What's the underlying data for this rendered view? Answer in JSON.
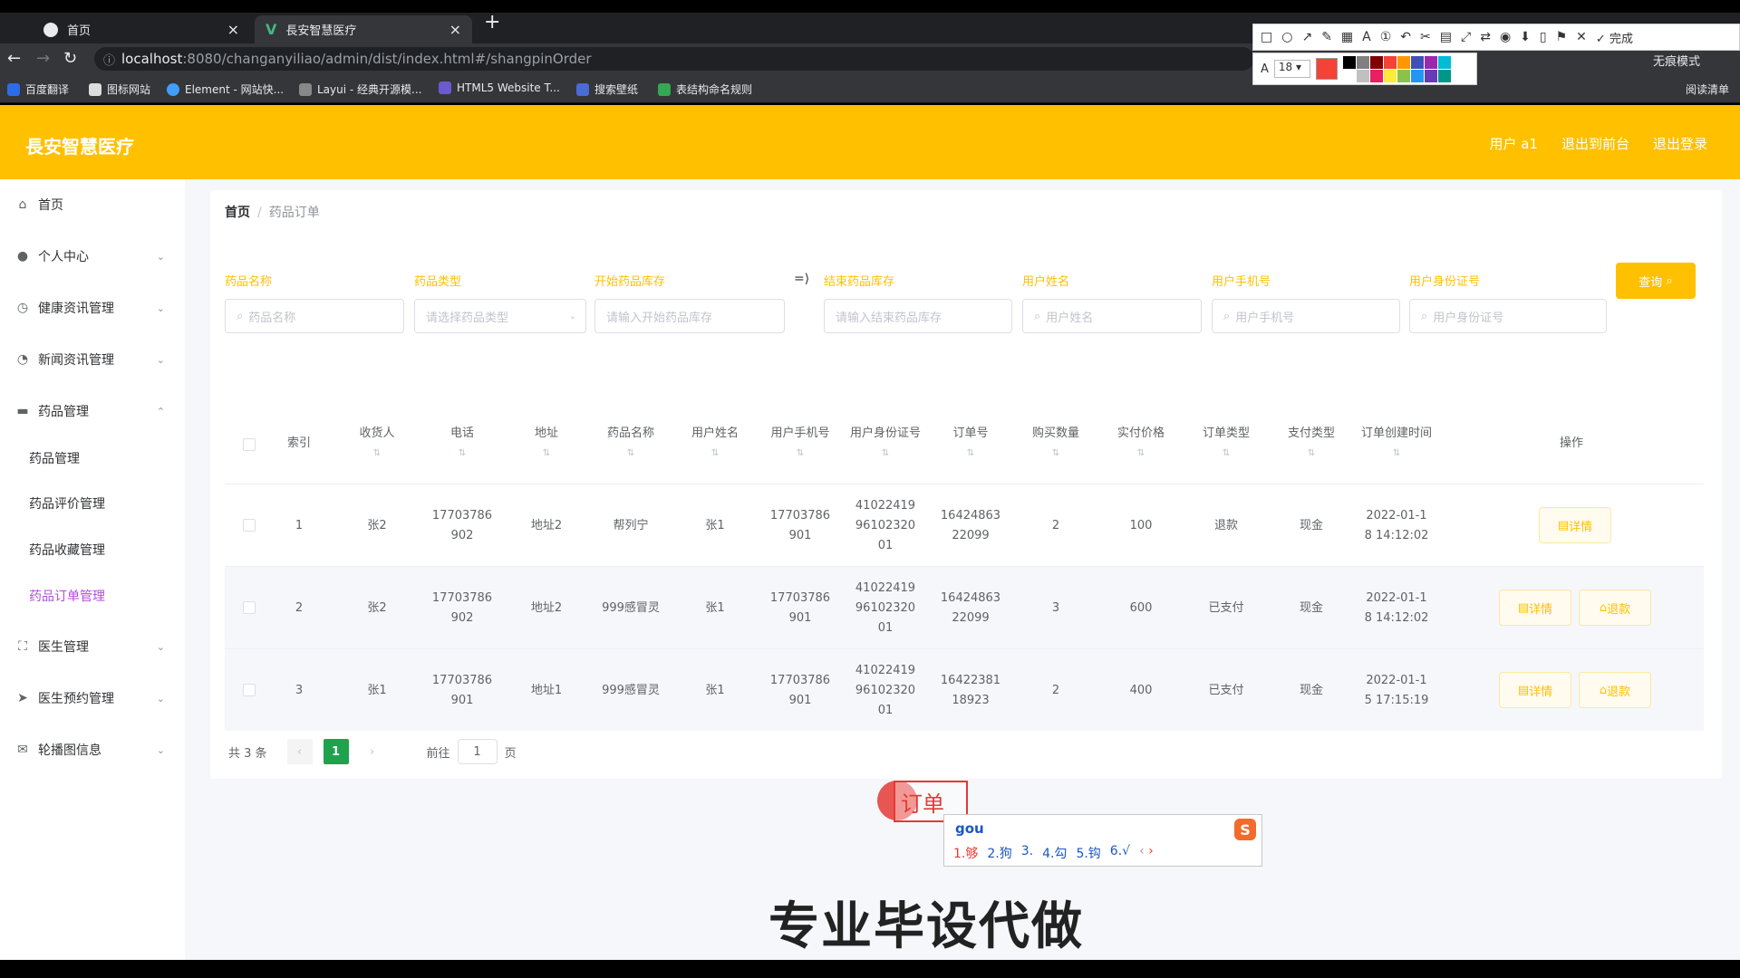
{
  "browser": {
    "tabs": [
      {
        "label": "首页"
      },
      {
        "label": "長安智慧医疗"
      }
    ],
    "url_host": "localhost",
    "url_path": ":8080/changanyiliao/admin/dist/index.html#/shangpinOrder",
    "incognito_label": "无痕模式",
    "bookmarks": [
      "百度翻译",
      "图标网站",
      "Element - 网站快...",
      "Layui - 经典开源模...",
      "HTML5 Website T...",
      "搜索壁纸",
      "表结构命名规则"
    ],
    "reading_list": "阅读清单"
  },
  "screenshot_tool": {
    "done_label": "完成",
    "font_size": "18",
    "current_color": "#f44336",
    "palette": [
      "#000000",
      "#808080",
      "#800000",
      "#f44336",
      "#ff9800",
      "#3f51b5",
      "#9c27b0",
      "#00bcd4",
      "#ffffff",
      "#c0c0c0",
      "#e91e63",
      "#ffeb3b",
      "#8bc34a",
      "#2196f3",
      "#673ab7",
      "#009688"
    ]
  },
  "app": {
    "title": "長安智慧医疗",
    "header_links": [
      "用户 a1",
      "退出到前台",
      "退出登录"
    ],
    "accent_color": "#ffc000"
  },
  "sidebar": {
    "items": [
      {
        "label": "首页",
        "icon": "home-icon"
      },
      {
        "label": "个人中心",
        "icon": "user-icon"
      },
      {
        "label": "健康资讯管理",
        "icon": "clock-icon"
      },
      {
        "label": "新闻资讯管理",
        "icon": "compass-icon"
      },
      {
        "label": "药品管理",
        "icon": "chat-icon"
      }
    ],
    "sub_items": [
      "药品管理",
      "药品评价管理",
      "药品收藏管理",
      "药品订单管理"
    ],
    "items_after": [
      {
        "label": "医生管理",
        "icon": "fullscreen-icon"
      },
      {
        "label": "医生预约管理",
        "icon": "send-icon"
      },
      {
        "label": "轮播图信息",
        "icon": "mail-icon"
      }
    ]
  },
  "breadcrumb": {
    "home": "首页",
    "current": "药品订单"
  },
  "filters": [
    {
      "label": "药品名称",
      "placeholder": "药品名称"
    },
    {
      "label": "药品类型",
      "placeholder": "请选择药品类型"
    },
    {
      "label": "开始药品库存",
      "placeholder": "请输入开始药品库存"
    },
    {
      "label": "结束药品库存",
      "placeholder": "请输入结束药品库存"
    },
    {
      "label": "用户姓名",
      "placeholder": "用户姓名"
    },
    {
      "label": "用户手机号",
      "placeholder": "用户手机号"
    },
    {
      "label": "用户身份证号",
      "placeholder": "用户身份证号"
    }
  ],
  "query_button": "查询",
  "table": {
    "headers": [
      "索引",
      "收货人",
      "电话",
      "地址",
      "药品名称",
      "用户姓名",
      "用户手机号",
      "用户身份证号",
      "订单号",
      "购买数量",
      "实付价格",
      "订单类型",
      "支付类型",
      "订单创建时间",
      "操作"
    ],
    "rows": [
      {
        "index": "1",
        "receiver": "张2",
        "phone": "17703786902",
        "address": "地址2",
        "drug": "帮列宁",
        "user": "张1",
        "user_phone": "17703786901",
        "id_card": "410224199610232001",
        "order_no": "1642486322099",
        "qty": "2",
        "price": "100",
        "order_type": "退款",
        "pay_type": "现金",
        "created": "2022-01-18 14:12:02",
        "actions": [
          "详情"
        ]
      },
      {
        "index": "2",
        "receiver": "张2",
        "phone": "17703786902",
        "address": "地址2",
        "drug": "999感冒灵",
        "user": "张1",
        "user_phone": "17703786901",
        "id_card": "410224199610232001",
        "order_no": "1642486322099",
        "qty": "3",
        "price": "600",
        "order_type": "已支付",
        "pay_type": "现金",
        "created": "2022-01-18 14:12:02",
        "actions": [
          "详情",
          "退款"
        ]
      },
      {
        "index": "3",
        "receiver": "张1",
        "phone": "17703786901",
        "address": "地址1",
        "drug": "999感冒灵",
        "user": "张1",
        "user_phone": "17703786901",
        "id_card": "410224199610232001",
        "order_no": "1642238118923",
        "qty": "2",
        "price": "400",
        "order_type": "已支付",
        "pay_type": "现金",
        "created": "2022-01-15 17:15:19",
        "actions": [
          "详情",
          "退款"
        ]
      }
    ]
  },
  "pagination": {
    "total": "共 3 条",
    "current": "1",
    "goto_label": "前往",
    "goto_value": "1",
    "page_suffix": "页"
  },
  "ime": {
    "preedit": "订单",
    "typed": "gou",
    "candidates": [
      "1.够",
      "2.狗",
      "3.",
      "4.勾",
      "5.钩",
      "6.√"
    ]
  },
  "watermark": "专业毕设代做"
}
